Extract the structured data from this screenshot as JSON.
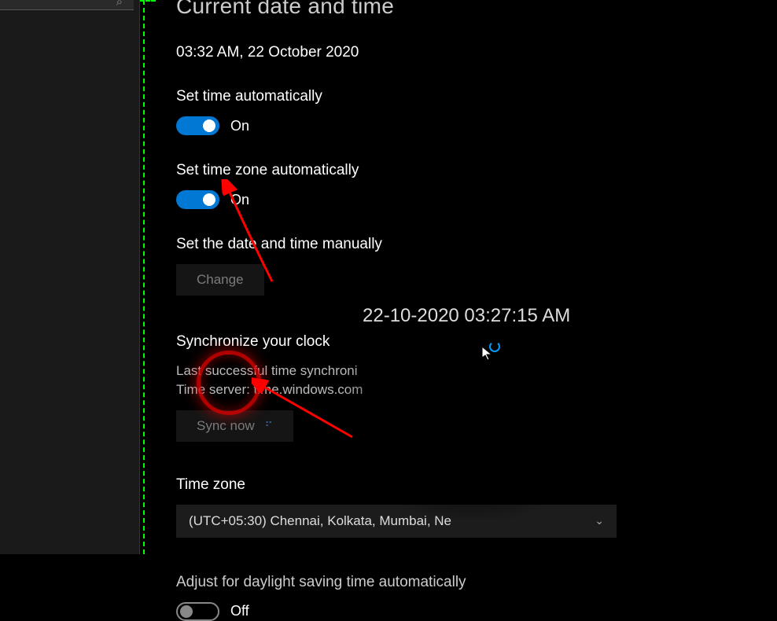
{
  "page": {
    "title": "Current date and time",
    "datetime": "03:32 AM, 22 October 2020"
  },
  "settings": {
    "set_time_auto": {
      "label": "Set time automatically",
      "state": "On"
    },
    "set_tz_auto": {
      "label": "Set time zone automatically",
      "state": "On"
    },
    "set_manual": {
      "label": "Set the date and time manually",
      "button": "Change"
    },
    "sync": {
      "title": "Synchronize your clock",
      "last_sync_line": "Last successful time synchroni",
      "server_line": "Time server: time.windows.com",
      "button": "Sync now"
    },
    "timezone": {
      "label": "Time zone",
      "selected": "(UTC+05:30) Chennai, Kolkata, Mumbai, Ne"
    },
    "dst": {
      "label": "Adjust for daylight saving time automatically",
      "state": "Off"
    }
  },
  "overlay": {
    "timestamp": "22-10-2020 03:27:15 AM"
  }
}
